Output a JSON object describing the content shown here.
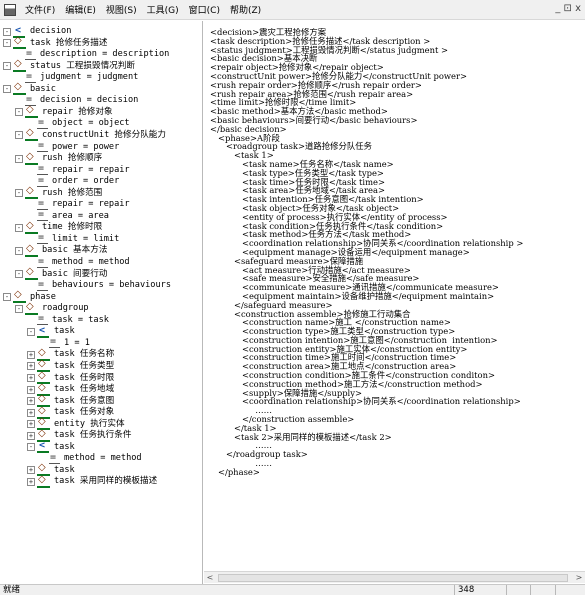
{
  "menu": {
    "items": [
      "文件(F)",
      "编辑(E)",
      "视图(S)",
      "工具(G)",
      "窗口(C)",
      "帮助(Z)"
    ],
    "window_controls": "_ ⊡ x"
  },
  "tree": {
    "nodes": [
      {
        "text": "decision",
        "kind": "decl",
        "depth": 0,
        "exp": "-"
      },
      {
        "text": "task 抢修任务描述",
        "kind": "elem",
        "depth": 0,
        "exp": "-"
      },
      {
        "text": "description = description",
        "kind": "attr",
        "depth": 1,
        "exp": ""
      },
      {
        "text": "status 工程损毁情况判断",
        "kind": "elem",
        "depth": 0,
        "exp": "-"
      },
      {
        "text": "judgment = judgment",
        "kind": "attr",
        "depth": 1,
        "exp": ""
      },
      {
        "text": "basic",
        "kind": "elem",
        "depth": 0,
        "exp": "-"
      },
      {
        "text": "decision = decision",
        "kind": "attr",
        "depth": 1,
        "exp": ""
      },
      {
        "text": "repair 抢修对象",
        "kind": "elem",
        "depth": 1,
        "exp": "-"
      },
      {
        "text": "object = object",
        "kind": "attr",
        "depth": 2,
        "exp": ""
      },
      {
        "text": "constructUnit 抢修分队能力",
        "kind": "elem",
        "depth": 1,
        "exp": "-"
      },
      {
        "text": "power = power",
        "kind": "attr",
        "depth": 2,
        "exp": ""
      },
      {
        "text": "rush 抢修顺序",
        "kind": "elem",
        "depth": 1,
        "exp": "-"
      },
      {
        "text": "repair = repair",
        "kind": "attr",
        "depth": 2,
        "exp": ""
      },
      {
        "text": "order = order",
        "kind": "attr",
        "depth": 2,
        "exp": ""
      },
      {
        "text": "rush 抢修范围",
        "kind": "elem",
        "depth": 1,
        "exp": "-"
      },
      {
        "text": "repair = repair",
        "kind": "attr",
        "depth": 2,
        "exp": ""
      },
      {
        "text": "area = area",
        "kind": "attr",
        "depth": 2,
        "exp": ""
      },
      {
        "text": "time 抢修时限",
        "kind": "elem",
        "depth": 1,
        "exp": "-"
      },
      {
        "text": "limit = limit",
        "kind": "attr",
        "depth": 2,
        "exp": ""
      },
      {
        "text": "basic 基本方法",
        "kind": "elem",
        "depth": 1,
        "exp": "-"
      },
      {
        "text": "method = method",
        "kind": "attr",
        "depth": 2,
        "exp": ""
      },
      {
        "text": "basic 间要行动",
        "kind": "elem",
        "depth": 1,
        "exp": "-"
      },
      {
        "text": "behaviours = behaviours",
        "kind": "attr",
        "depth": 2,
        "exp": ""
      },
      {
        "text": "phase",
        "kind": "elem",
        "depth": 0,
        "exp": "-"
      },
      {
        "text": "roadgroup",
        "kind": "elem",
        "depth": 1,
        "exp": "-"
      },
      {
        "text": "task = task",
        "kind": "attr",
        "depth": 2,
        "exp": ""
      },
      {
        "text": "task",
        "kind": "decl",
        "depth": 2,
        "exp": "-"
      },
      {
        "text": "1 = 1",
        "kind": "attr",
        "depth": 3,
        "exp": ""
      },
      {
        "text": "task 任务名称",
        "kind": "elem",
        "depth": 2,
        "exp": "+"
      },
      {
        "text": "task 任务类型",
        "kind": "elem",
        "depth": 2,
        "exp": "+"
      },
      {
        "text": "task 任务时限",
        "kind": "elem",
        "depth": 2,
        "exp": "+"
      },
      {
        "text": "task 任务地域",
        "kind": "elem",
        "depth": 2,
        "exp": "+"
      },
      {
        "text": "task 任务意图",
        "kind": "elem",
        "depth": 2,
        "exp": "+"
      },
      {
        "text": "task 任务对象",
        "kind": "elem",
        "depth": 2,
        "exp": "+"
      },
      {
        "text": "entity 执行实体",
        "kind": "elem",
        "depth": 2,
        "exp": "+"
      },
      {
        "text": "task 任务执行条件",
        "kind": "elem",
        "depth": 2,
        "exp": "+"
      },
      {
        "text": "task",
        "kind": "decl",
        "depth": 2,
        "exp": "-"
      },
      {
        "text": "method = method",
        "kind": "attr",
        "depth": 3,
        "exp": ""
      },
      {
        "text": "task",
        "kind": "elem",
        "depth": 2,
        "exp": "+"
      },
      {
        "text": "task 采用同样的模板描述",
        "kind": "elem",
        "depth": 2,
        "exp": "+"
      }
    ]
  },
  "content": {
    "lines": [
      "<decision>震灾工程抢修方案",
      "<task description>抢修任务描述</task description >",
      "<status judgment>工程损毁情况判断</status judgment >",
      "<basic decision>基本决断",
      "<repair object>抢修对象</repair object>",
      "<constructUnit power>抢修分队能力</constructUnit power>",
      "<rush repair order>抢修顺序</rush repair order>",
      "<rush repair area>抢修范围</rush repair area>",
      "<time limit>抢修时限</time limit>",
      "<basic method>基本方法</basic method>",
      "<basic behaviours>间要行动</basic behaviours>",
      "</basic decision>",
      "   <phase>A阶段",
      "      <roadgroup task>道路抢修分队任务",
      "         <task 1>",
      "            <task name>任务名称</task name>",
      "            <task type>任务类型</task type>",
      "            <task time>任务时限</task time>",
      "            <task area>任务地域</task area>",
      "            <task intention>任务意图</task intention>",
      "            <task object>任务对象</task object>",
      "            <entity of process>执行实体</entity of process>",
      "            <task condition>任务执行条件</task condition>",
      "            <task method>任务方法</task method>",
      "            <coordination relationship>协同关系</coordination relationship >",
      "            <equipment manage>设备运用</equipment manage>",
      "         <safeguard measure>保障措施",
      "            <act measure>行动措施</act measure>",
      "            <safe measure>安全措施</safe measure>",
      "            <communicate measure>通讯措施</communicate measure>",
      "            <equipment maintain>设备维护措施</equipment maintain>",
      "         </safeguard measure>",
      "         <construction assemble>抢修施工行动集合",
      "            <construction name>施工 </construction name>",
      "            <construction type>施工类型</construction type>",
      "            <construction intention>施工意图</construction  intention>",
      "            <construction entity>施工实体</construction entity>",
      "            <construction time>施工时间</construction time>",
      "            <construction area>施工地点</construction area>",
      "            <construction condition>施工条件</construction conditon>",
      "            <construction method>施工方法</construction method>",
      "            <supply>保障措施</supply>",
      "            <coordination relationship>协同关系</coordination relationship>",
      "                 ……",
      "            </construction assemble>",
      "         </task 1>",
      "         <task 2>采用同样的模板描述</task 2>",
      "                 ……",
      "      </roadgroup task>",
      "                 ……",
      "   </phase>"
    ]
  },
  "scrollbar": {
    "left_arrow": "<",
    "right_arrow": ">"
  },
  "status": {
    "text": "就绪",
    "position": "348"
  }
}
